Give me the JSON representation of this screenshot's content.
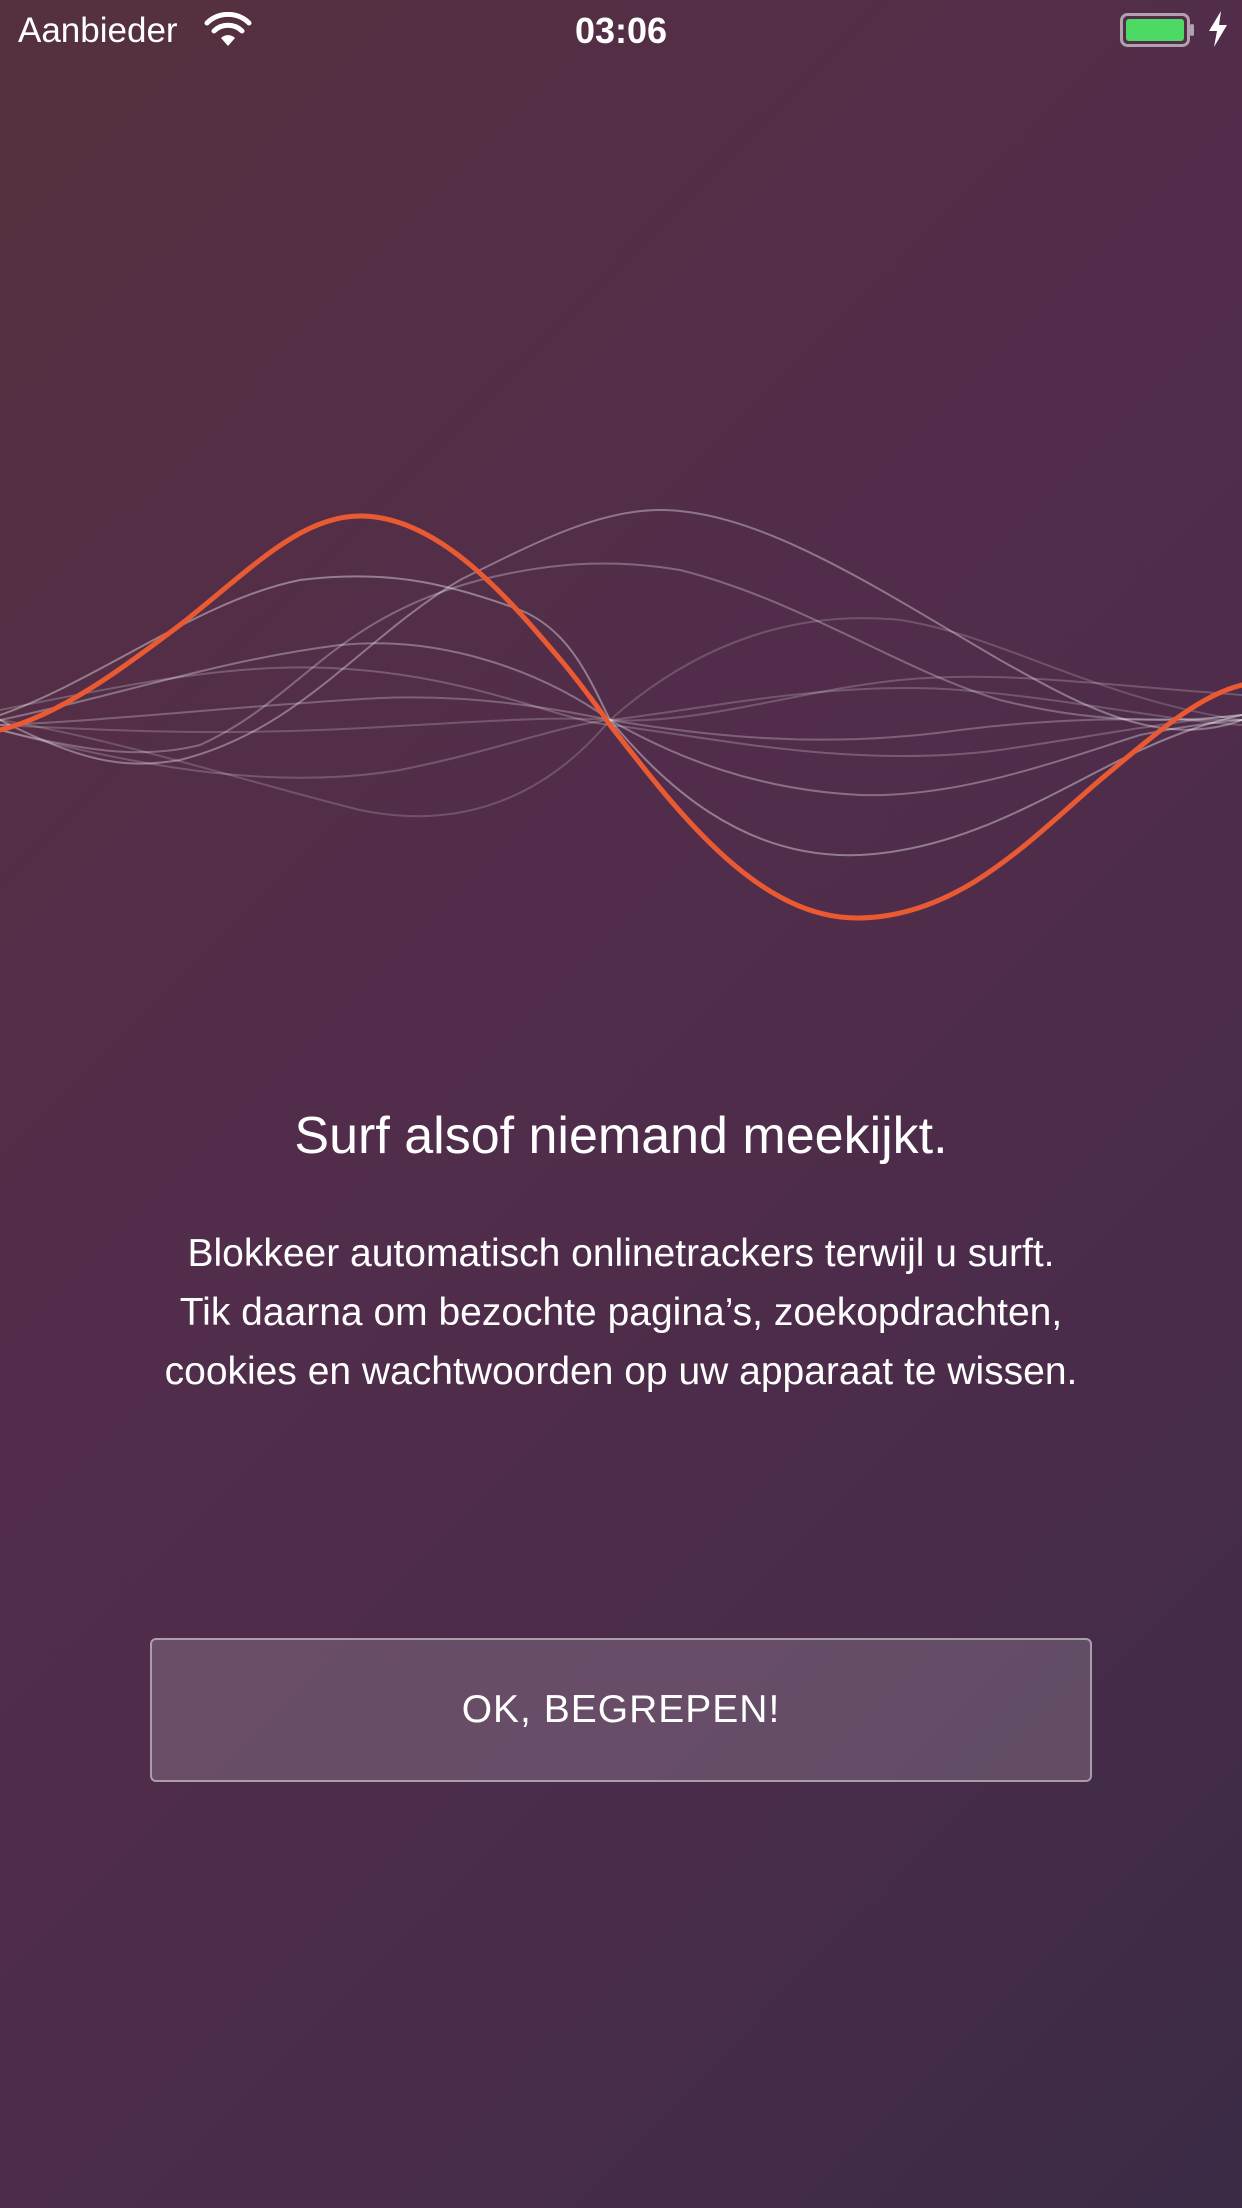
{
  "status_bar": {
    "carrier": "Aanbieder",
    "time": "03:06",
    "wifi_icon": "wifi-icon",
    "battery_icon": "battery-icon",
    "charging_icon": "charging-bolt-icon",
    "battery_color": "#4cd964"
  },
  "illustration": {
    "icon": "waveform-illustration",
    "accent_color": "#ea5a32"
  },
  "onboarding": {
    "title": "Surf alsof niemand meekijkt.",
    "description": "Blokkeer automatisch onlinetrackers terwijl u surft. Tik daarna om bezochte pagina’s, zoekopdrachten, cookies en wachtwoorden op uw apparaat te wissen.",
    "confirm_button": "OK, BEGREPEN!"
  }
}
